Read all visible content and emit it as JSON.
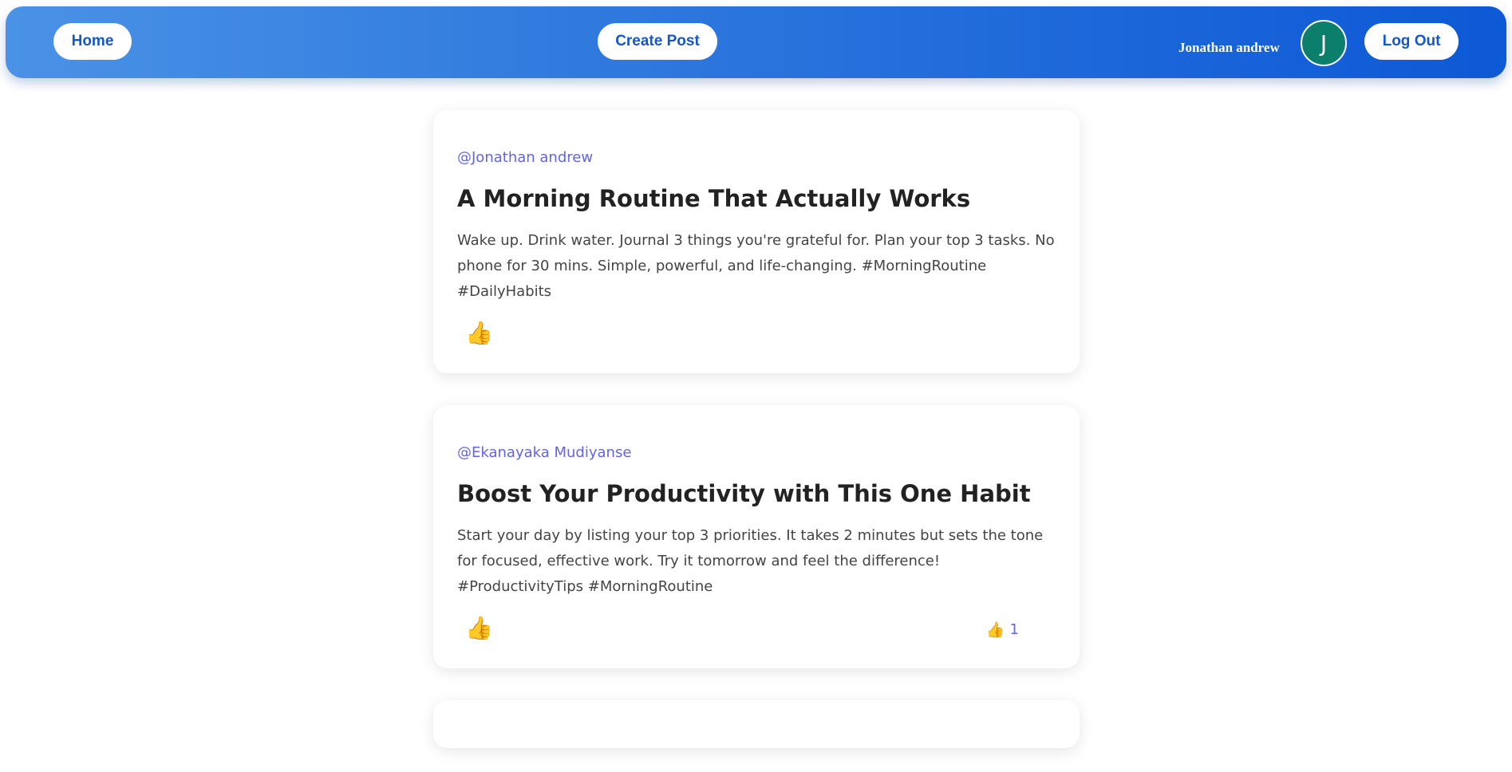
{
  "navbar": {
    "home_label": "Home",
    "create_label": "Create Post",
    "username": "Jonathan andrew",
    "avatar_initial": "J",
    "logout_label": "Log Out"
  },
  "posts": [
    {
      "author": "@Jonathan andrew",
      "title": "A Morning Routine That Actually Works",
      "body": "Wake up. Drink water. Journal 3 things you're grateful for. Plan your top 3 tasks. No phone for 30 mins. Simple, powerful, and life-changing. #MorningRoutine #DailyHabits",
      "like_icon": "👍",
      "like_count": null
    },
    {
      "author": "@Ekanayaka Mudiyanse",
      "title": "Boost Your Productivity with This One Habit",
      "body": "Start your day by listing your top 3 priorities. It takes 2 minutes but sets the tone for focused, effective work. Try it tomorrow and feel the difference! #ProductivityTips #MorningRoutine",
      "like_icon": "👍",
      "like_count": "1"
    }
  ],
  "colors": {
    "nav_gradient_start": "#4a92e6",
    "nav_gradient_end": "#0d59d6",
    "button_text": "#1457c9",
    "avatar_bg": "#0b7f6b",
    "author_text": "#6464e6"
  }
}
